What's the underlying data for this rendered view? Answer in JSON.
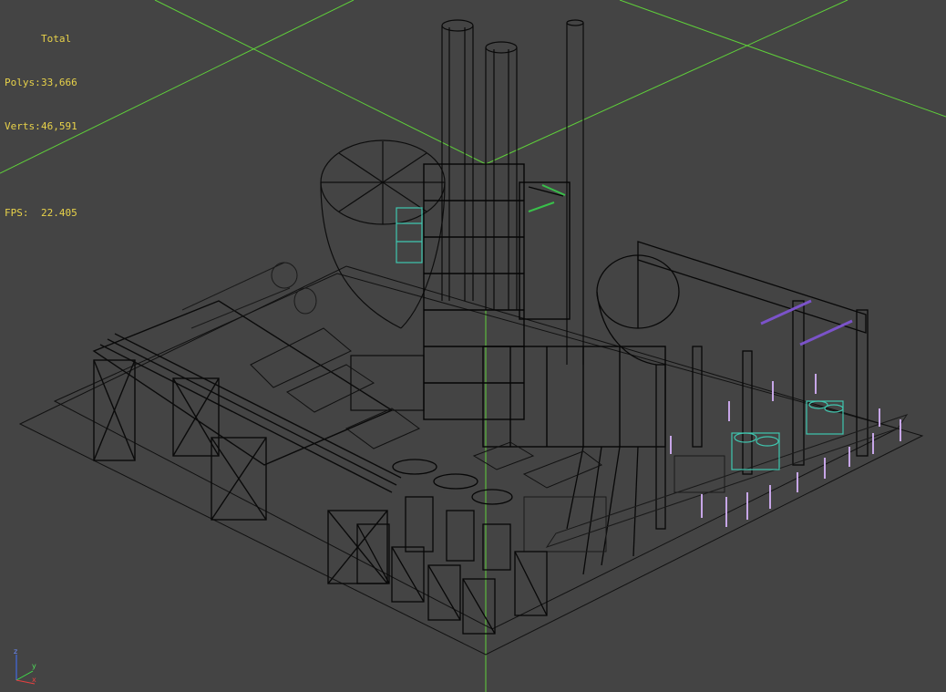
{
  "stats": {
    "header": "Total",
    "polys_label": "Polys:",
    "polys_value": "33,666",
    "verts_label": "Verts:",
    "verts_value": "46,591",
    "fps_label": "FPS:",
    "fps_value": "22.405"
  },
  "axis_gizmo": {
    "x": "x",
    "y": "y",
    "z": "z"
  },
  "colors": {
    "background": "#444444",
    "grid": "#5fd03a",
    "wireframe": "#000000",
    "stats_text": "#e8d24a",
    "selection_cyan": "#3fc7b0",
    "selection_purple": "#7b53c9",
    "posts_lilac": "#c7a6e8"
  }
}
